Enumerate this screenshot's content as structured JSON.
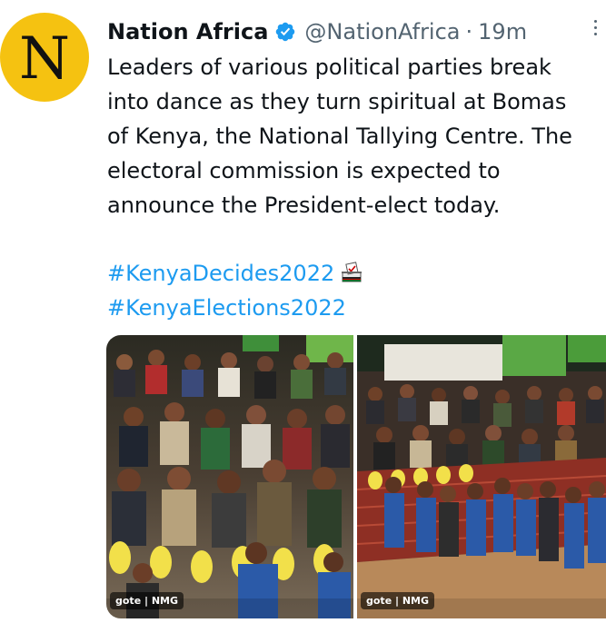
{
  "tweet": {
    "avatar_letter": "N",
    "display_name": "Nation Africa",
    "verified_icon": "verified-badge-icon",
    "handle": "@NationAfrica",
    "separator": "·",
    "time": "19m",
    "more_icon": "more-options-icon",
    "text_lines": [
      "Leaders of various political parties break",
      "into dance as they turn spiritual at Bomas",
      "of Kenya, the National Tallying Centre. The",
      "electoral commission is expected to",
      "announce the President-elect today."
    ],
    "hashtags": [
      "#KenyaDecides2022",
      "#KenyaElections2022"
    ],
    "ballot_icon": "ballot-box-icon"
  },
  "media": [
    {
      "credit": "gote | NMG"
    },
    {
      "credit": "gote | NMG"
    }
  ],
  "colors": {
    "link": "#1d9bf0",
    "muted": "#536471",
    "avatar_bg": "#f5c211",
    "verified": "#1d9bf0"
  }
}
